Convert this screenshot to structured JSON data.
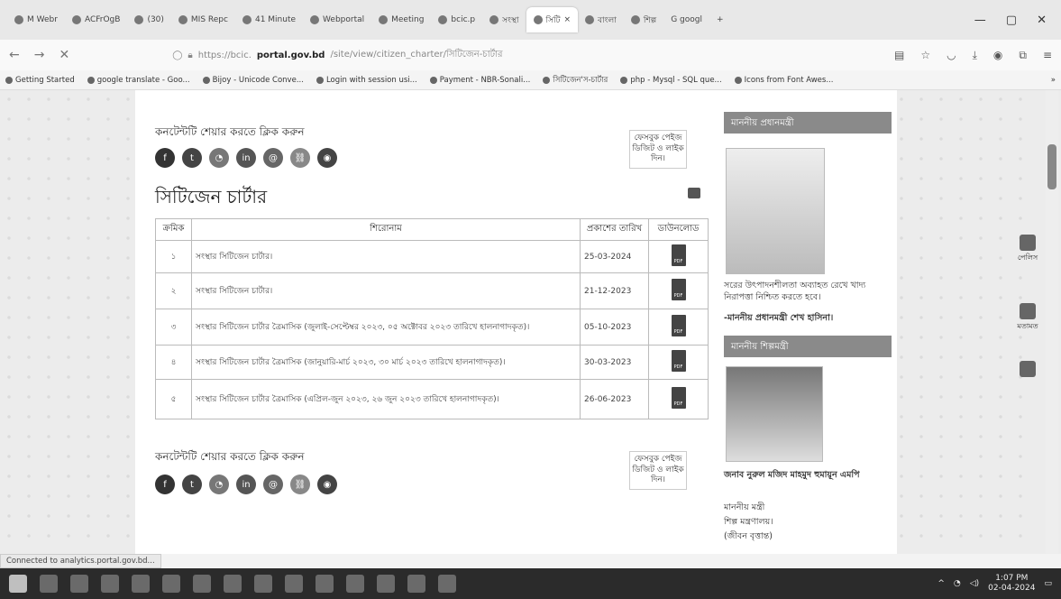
{
  "browser": {
    "tabs": [
      {
        "label": "M Webr"
      },
      {
        "label": "ACFrOgB"
      },
      {
        "label": "(30)"
      },
      {
        "label": "MIS Repc"
      },
      {
        "label": "41 Minute"
      },
      {
        "label": "Webportal"
      },
      {
        "label": "Meeting"
      },
      {
        "label": "bcic.p"
      },
      {
        "label": "সংস্থা"
      },
      {
        "label": "সিটি"
      },
      {
        "label": "বাংলা"
      },
      {
        "label": "শিল্প"
      },
      {
        "label": "G googl"
      }
    ],
    "new_tab": "+",
    "url_prefix": "https://bcic.",
    "url_domain": "portal.gov.bd",
    "url_path": "/site/view/citizen_charter/সিটিজেন-চার্টার",
    "bookmarks": [
      "Getting Started",
      "google translate - Goo...",
      "Bijoy - Unicode Conve...",
      "Login with session usi...",
      "Payment - NBR-Sonali...",
      "সিটিজেন'স-চার্টার",
      "php - Mysql - SQL que...",
      "Icons from Font Awes..."
    ]
  },
  "content": {
    "share_title": "কনটেন্টটি শেয়ার করতে ক্লিক করুন",
    "fb_like": "ফেসবুক পেইজ ডিজিট ও লাইক দিন।",
    "heading": "সিটিজেন চার্টার",
    "table": {
      "headers": [
        "ক্রমিক",
        "শিরোনাম",
        "প্রকাশের তারিখ",
        "ডাউনলোড"
      ],
      "rows": [
        {
          "sn": "১",
          "title": "সংস্থার সিটিজেন চার্টার।",
          "date": "25-03-2024"
        },
        {
          "sn": "২",
          "title": "সংস্থার সিটিজেন চার্টার।",
          "date": "21-12-2023"
        },
        {
          "sn": "৩",
          "title": "সংস্থার সিটিজেন চার্টার ত্রৈমাসিক (জুলাই-সেপ্টেম্বর ২০২৩, ০৫ অক্টোবর ২০২৩ তারিখে হালনাগাদকৃত)।",
          "date": "05-10-2023"
        },
        {
          "sn": "৪",
          "title": "সংস্থার সিটিজেন চার্টার ত্রৈমাসিক (জানুয়ারি-মার্চ ২০২৩, ৩০ মার্চ ২০২৩ তারিখে হালনাগাদকৃত)।",
          "date": "30-03-2023"
        },
        {
          "sn": "৫",
          "title": "সংস্থার সিটিজেন চার্টার ত্রৈমাসিক (এপ্রিল-জুন ২০২৩, ২৬ জুন ২০২৩ তারিখে হালনাগাদকৃত)।",
          "date": "26-06-2023"
        }
      ],
      "pdf_label": "PDF"
    }
  },
  "sidebar": {
    "pm_heading": "মাননীয় প্রধানমন্ত্রী",
    "pm_quote": "সরের উৎপাদনশীলতা অব্যাহত রেখে খাদ্য নিরাপত্তা নিশ্চিত করতে হবে।",
    "pm_attribution": "-মাননীয় প্রধানমন্ত্রী শেখ হাসিনা।",
    "minister_heading": "মাননীয় শিল্পমন্ত্রী",
    "minister_name": "জনাব নুরুল মজিদ মাহমুদ হুমায়ূন এমপি",
    "minister_title": "মাননীয় মন্ত্রী",
    "minister_ministry": "শিল্প মন্ত্রণালয়।",
    "minister_bio": "(জীবন বৃত্তান্ত)"
  },
  "floating_tools": {
    "accessibility": "পেলিস",
    "feedback": "মতামত"
  },
  "status_bar": "Connected to analytics.portal.gov.bd...",
  "taskbar": {
    "time": "1:07 PM",
    "date": "02-04-2024"
  },
  "colors": {
    "share_icons": [
      "#333333",
      "#444444",
      "#777777",
      "#555555",
      "#666666",
      "#888888",
      "#444444"
    ],
    "side_head": "#8a8a8a"
  }
}
